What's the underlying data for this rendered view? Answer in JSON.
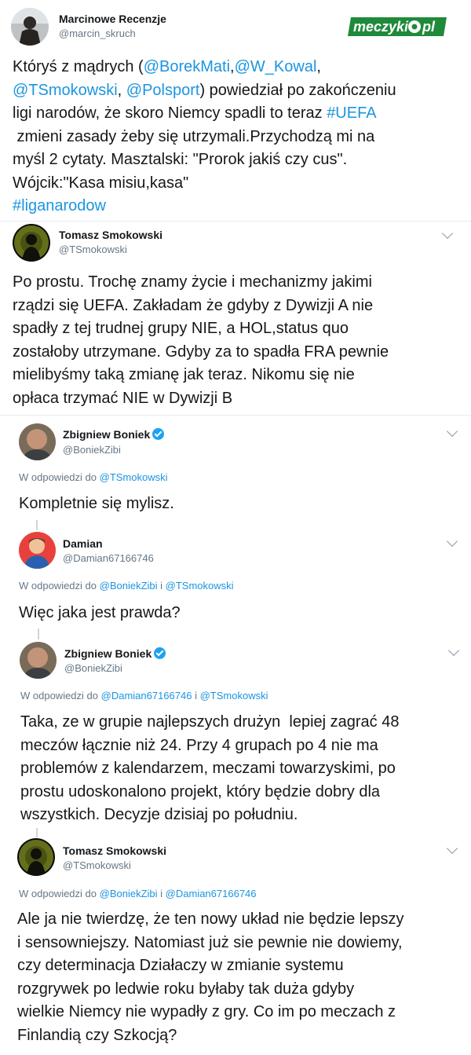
{
  "watermark": {
    "text_left": "meczyki",
    "text_right": "pl"
  },
  "tweets": [
    {
      "author": "Marcinowe Recenzje",
      "handle": "@marcin_skruch",
      "lines": [
        [
          {
            "t": "Któryś z mądrych ("
          },
          {
            "t": "@BorekMati",
            "l": 1
          },
          {
            "t": ","
          },
          {
            "t": "@W_Kowal",
            "l": 1
          },
          {
            "t": ","
          }
        ],
        [
          {
            "t": "@TSmokowski",
            "l": 1
          },
          {
            "t": ", "
          },
          {
            "t": "@Polsport",
            "l": 1
          },
          {
            "t": ") powiedział po zakończeniu"
          }
        ],
        [
          {
            "t": "ligi narodów, że skoro Niemcy spadli to teraz "
          },
          {
            "t": "#UEFA",
            "l": 1
          }
        ],
        [
          {
            "t": " zmieni zasady żeby się utrzymali.Przychodzą mi na"
          }
        ],
        [
          {
            "t": "myśl 2 cytaty. Masztalski: \"Prorok jakiś czy cus\"."
          }
        ],
        [
          {
            "t": "Wójcik:\"Kasa misiu,kasa\""
          }
        ],
        [
          {
            "t": "#liganarodow",
            "l": 1
          }
        ]
      ]
    },
    {
      "author": "Tomasz Smokowski",
      "handle": "@TSmokowski",
      "lines": [
        [
          {
            "t": "Po prostu. Trochę znamy życie i mechanizmy jakimi"
          }
        ],
        [
          {
            "t": "rządzi się UEFA. Zakładam że gdyby z Dywizji A nie"
          }
        ],
        [
          {
            "t": "spadły z tej trudnej grupy NIE, a HOL,status quo"
          }
        ],
        [
          {
            "t": "zostałoby utrzymane. Gdyby za to spadła FRA pewnie"
          }
        ],
        [
          {
            "t": "mielibyśmy taką zmianę jak teraz. Nikomu się nie"
          }
        ],
        [
          {
            "t": "opłaca trzymać NIE w Dywizji B"
          }
        ]
      ]
    },
    {
      "author": "Zbigniew Boniek",
      "handle": "@BoniekZibi",
      "reply_prefix": "W odpowiedzi do",
      "reply_to": [
        "@TSmokowski"
      ],
      "lines": [
        [
          {
            "t": "Kompletnie się mylisz."
          }
        ]
      ]
    },
    {
      "author": "Damian",
      "handle": "@Damian67166746",
      "reply_prefix": "W odpowiedzi do",
      "reply_joiner": "i",
      "reply_to": [
        "@BoniekZibi",
        "@TSmokowski"
      ],
      "lines": [
        [
          {
            "t": "Więc jaka jest prawda?"
          }
        ]
      ]
    },
    {
      "author": "Zbigniew Boniek",
      "handle": "@BoniekZibi",
      "reply_prefix": "W odpowiedzi do",
      "reply_joiner": "i",
      "reply_to": [
        "@Damian67166746",
        "@TSmokowski"
      ],
      "lines": [
        [
          {
            "t": "Taka, ze w grupie najlepszych drużyn  lepiej zagrać 48"
          }
        ],
        [
          {
            "t": "meczów łącznie niż 24. Przy 4 grupach po 4 nie ma"
          }
        ],
        [
          {
            "t": "problemów z kalendarzem, meczami towarzyskimi, po"
          }
        ],
        [
          {
            "t": "prostu udoskonalono projekt, który będzie dobry dla"
          }
        ],
        [
          {
            "t": "wszystkich. Decyzje dzisiaj po południu."
          }
        ]
      ]
    },
    {
      "author": "Tomasz Smokowski",
      "handle": "@TSmokowski",
      "reply_prefix": "W odpowiedzi do",
      "reply_joiner": "i",
      "reply_to": [
        "@BoniekZibi",
        "@Damian67166746"
      ],
      "lines": [
        [
          {
            "t": "Ale ja nie twierdzę, że ten nowy układ nie będzie lepszy"
          }
        ],
        [
          {
            "t": "i sensowniejszy. Natomiast już sie pewnie nie dowiemy,"
          }
        ],
        [
          {
            "t": "czy determinacja Działaczy w zmianie systemu"
          }
        ],
        [
          {
            "t": "rozgrywek po ledwie roku byłaby tak duża gdyby"
          }
        ],
        [
          {
            "t": "wielkie Niemcy nie wypadły z gry. Co im po meczach z"
          }
        ],
        [
          {
            "t": "Finlandią czy Szkocją?"
          }
        ]
      ]
    }
  ]
}
